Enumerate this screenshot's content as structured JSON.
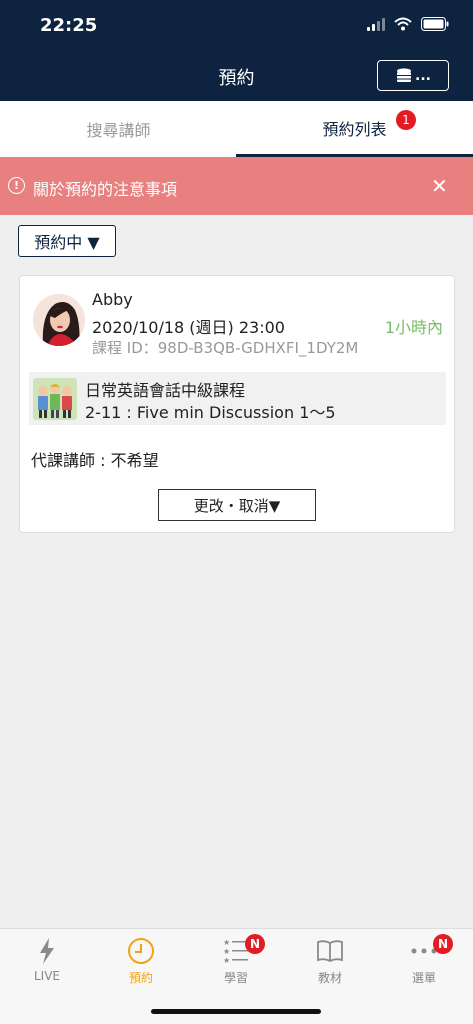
{
  "status_bar": {
    "time": "22:25"
  },
  "header": {
    "title": "預約",
    "coin_button_label": "..."
  },
  "tabs": [
    {
      "label": "搜尋講師",
      "active": false
    },
    {
      "label": "預約列表",
      "active": true,
      "badge": "1"
    }
  ],
  "notice": {
    "text": "關於預約的注意事項",
    "close": "✕"
  },
  "filter": {
    "label": "預約中 ▼"
  },
  "reservation": {
    "teacher": "Abby",
    "datetime": "2020/10/18 (週日) 23:00",
    "countdown": "1小時內",
    "course_id": "課程 ID：98D-B3QB-GDHXFI_1DY2M",
    "course_title": "日常英語會話中級課程",
    "lesson": "2-11 : Five min Discussion 1～5",
    "substitute": "代課講師 : 不希望",
    "change_button": "更改・取消▼"
  },
  "bottom_nav": [
    {
      "label": "LIVE",
      "icon": "lightning-icon"
    },
    {
      "label": "預約",
      "icon": "clock-icon",
      "active": true
    },
    {
      "label": "學習",
      "icon": "star-list-icon",
      "badge": "N"
    },
    {
      "label": "教材",
      "icon": "book-icon"
    },
    {
      "label": "選單",
      "icon": "more-icon",
      "badge": "N"
    }
  ],
  "colors": {
    "navy": "#0d2340",
    "notice": "#e88080",
    "active_tab": "#f0a31a",
    "countdown": "#7cbb6a",
    "badge": "#e31b23"
  }
}
